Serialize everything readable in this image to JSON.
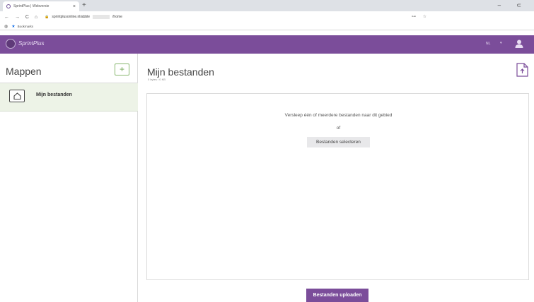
{
  "browser": {
    "tab_title": "SprintPlus | Webversie",
    "tab_close": "×",
    "new_tab": "+",
    "window_controls": "– ⊂",
    "nav_back": "←",
    "nav_forward": "→",
    "nav_reload": "C",
    "nav_home": "⌂",
    "lock": "🔒",
    "url_prefix": "sprintplusonline.nl/abble",
    "url_suffix": "/home",
    "addr_icons": "⊶ ☆",
    "bookmark_label": "Bookmarks"
  },
  "app": {
    "brand": "SprintPlus",
    "language": "NL",
    "language_caret": "▾",
    "accent": "#7b4d9a"
  },
  "sidebar": {
    "title": "Mappen",
    "add_folder_icon": "+",
    "items": [
      {
        "label": "Mijn bestanden",
        "icon": "home-icon",
        "selected": true
      }
    ]
  },
  "main": {
    "title": "Mijn bestanden",
    "subtitle": "0 bytes / 0 KB",
    "dropzone_text": "Versleep één of meerdere bestanden naar dit gebied",
    "dropzone_or": "of",
    "select_button": "Bestanden selecteren",
    "upload_button": "Bestanden uploaden"
  }
}
